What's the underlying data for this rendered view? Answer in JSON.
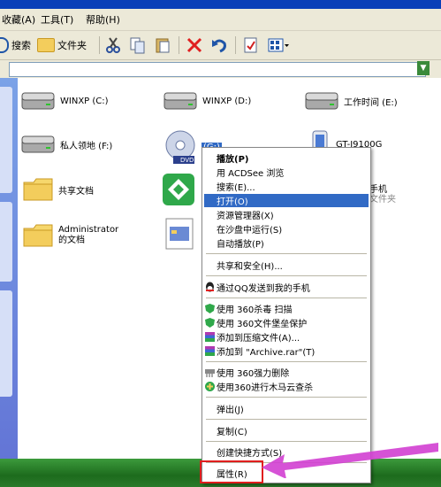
{
  "menubar": {
    "items": [
      "收藏(A)",
      "工具(T)",
      "帮助(H)"
    ]
  },
  "toolbar": {
    "search_label": "搜索",
    "folders_label": "文件夹"
  },
  "drives": [
    {
      "label": "WINXP (C:)"
    },
    {
      "label": "WINXP (D:)"
    },
    {
      "label": "工作时间 (E:)"
    },
    {
      "label": "私人领地 (F:)"
    },
    {
      "label": "(G:)"
    },
    {
      "label": "GT-I9100G"
    }
  ],
  "folders": [
    {
      "label": "共享文档"
    },
    {
      "label": "Administrator 的文档"
    }
  ],
  "partial_items": {
    "phone_line1": "手机",
    "phone_line2": "文件夹",
    "dvd_badge": "DVD"
  },
  "context_menu": {
    "items": [
      {
        "label": "播放(P)",
        "bold": true
      },
      {
        "label": "用 ACDSee 浏览"
      },
      {
        "label": "搜索(E)..."
      },
      {
        "label": "打开(O)",
        "highlight": true
      },
      {
        "label": "资源管理器(X)"
      },
      {
        "label": "在沙盘中运行(S)"
      },
      {
        "label": "自动播放(P)"
      },
      {
        "label": "共享和安全(H)..."
      },
      {
        "label": "通过QQ发送到我的手机"
      },
      {
        "label": "使用 360杀毒 扫描"
      },
      {
        "label": "使用 360文件堡垒保护"
      },
      {
        "label": "添加到压缩文件(A)..."
      },
      {
        "label": "添加到 \"Archive.rar\"(T)"
      },
      {
        "label": "使用 360强力删除"
      },
      {
        "label": "使用360进行木马云查杀"
      },
      {
        "label": "弹出(J)"
      },
      {
        "label": "复制(C)"
      },
      {
        "label": "创建快捷方式(S)"
      },
      {
        "label": "属性(R)"
      }
    ]
  },
  "colors": {
    "highlight": "#316ac5",
    "annotation": "#e01e1e",
    "arrow": "#d23fd2"
  }
}
